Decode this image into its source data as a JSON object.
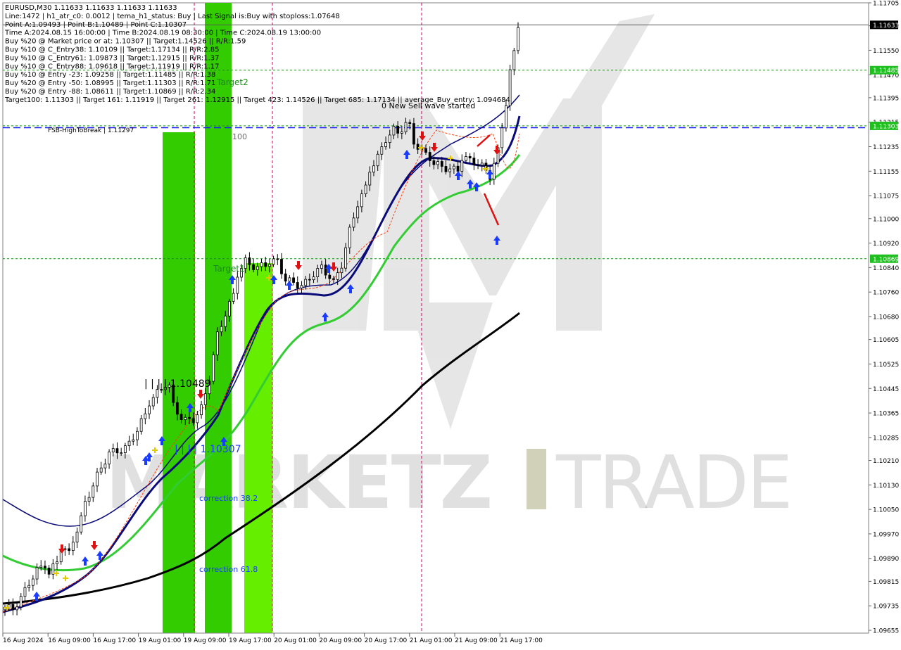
{
  "chart_header": {
    "info_lines": [
      "EURUSD,M30  1.11633 1.11633 1.11633 1.11633",
      "Line:1472  |  h1_atr_c0: 0.0012  |  tema_h1_status: Buy  |  Last Signal is:Buy with stoploss:1.07648",
      "Point A:1.09493  |  Point B:1.10489  |  Point C:1.10307",
      "Time A:2024.08.15 16:00:00  |  Time B:2024.08.19 08:30:00  |  Time C:2024.08.19 13:00:00",
      "Buy %20 @ Market price or at: 1.10307  ||  Target:1.14526  ||  R/R:1.59",
      "Buy %10 @ C_Entry38: 1.10109  ||  Target:1.17134  ||  R/R:2.85",
      "Buy %10 @ C_Entry61: 1.09873  ||  Target:1.12915  ||  R/R:1.37",
      "Buy %10 @ C_Entry88: 1.09618  ||  Target:1.11919  ||  R/R:1.17",
      "Buy %10 @ Entry -23: 1.09258  ||  Target:1.11485  ||  R/R:1.38",
      "Buy %20 @ Entry -50: 1.08995  ||  Target:1.11303  ||  R/R:1.71",
      "Buy %20 @ Entry -88: 1.08611  ||  Target:1.10869  ||  R/R:2.34",
      "Target100: 1.11303  ||  Target 161: 1.11919  ||  Target 261: 1.12915  ||  Target 423: 1.14526  ||  Target 685: 1.17134  ||  average_Buy_entry: 1.094684"
    ]
  },
  "annotations": {
    "target2": "Target2",
    "target1": "Target1",
    "fsb": "FSB-HighToBreak  |  1.11297",
    "level_100": "100",
    "new_sell": "0 New Sell wave started",
    "point_b_label": "| | | | 1.10489",
    "point_c_label": "| | | | 1.10307",
    "correction_382": "correction 38.2",
    "correction_618": "correction 61.8"
  },
  "watermark": {
    "brand_left": "MARKETZ",
    "brand_right": "TRADE"
  },
  "price_tags": [
    {
      "value": "1.11633",
      "price": 1.11633,
      "bg": "#000000",
      "fg": "#ffffff"
    },
    {
      "value": "1.11485",
      "price": 1.11485,
      "bg": "#1fbf1f",
      "fg": "#ffffff"
    },
    {
      "value": "1.11303",
      "price": 1.11303,
      "bg": "#1fbf1f",
      "fg": "#ffffff"
    },
    {
      "value": "1.10869",
      "price": 1.10869,
      "bg": "#1fbf1f",
      "fg": "#ffffff"
    }
  ],
  "colors": {
    "zone_green": "#33cc00",
    "zone_green_light": "#66ee00",
    "candle": "#000000",
    "ma_blue": "#0a0a78",
    "ma_green": "#33cc33",
    "ma_black": "#000000",
    "level_green": "#1a8c1a",
    "level_blue": "#1a1aff",
    "vline": "#cc0066",
    "buy_arrow": "#1a3cff",
    "sell_arrow": "#e01010"
  },
  "chart_data": {
    "type": "candlestick",
    "symbol": "EURUSD",
    "timeframe": "M30",
    "ylim": [
      1.09655,
      1.11705
    ],
    "y_ticks": [
      "1.11705",
      "1.11630",
      "1.11550",
      "1.11470",
      "1.11395",
      "1.11315",
      "1.11235",
      "1.11155",
      "1.11075",
      "1.11000",
      "1.10920",
      "1.10840",
      "1.10760",
      "1.10680",
      "1.10605",
      "1.10525",
      "1.10445",
      "1.10365",
      "1.10285",
      "1.10210",
      "1.10130",
      "1.10050",
      "1.09970",
      "1.09890",
      "1.09815",
      "1.09735",
      "1.09655"
    ],
    "x_ticks": [
      "16 Aug 2024",
      "16 Aug 09:00",
      "16 Aug 17:00",
      "19 Aug 01:00",
      "19 Aug 09:00",
      "19 Aug 17:00",
      "20 Aug 01:00",
      "20 Aug 09:00",
      "20 Aug 17:00",
      "21 Aug 01:00",
      "21 Aug 09:00",
      "21 Aug 17:00"
    ],
    "levels": [
      {
        "name": "current",
        "price": 1.11633
      },
      {
        "name": "target2",
        "price": 1.11485
      },
      {
        "name": "target100",
        "price": 1.11303
      },
      {
        "name": "fsb-high-to-break",
        "price": 1.11297
      },
      {
        "name": "target1",
        "price": 1.10869
      }
    ],
    "close_path": [
      [
        0,
        1.0973
      ],
      [
        2,
        1.09725
      ],
      [
        4,
        1.0976
      ],
      [
        6,
        1.0981
      ],
      [
        8,
        1.0985
      ],
      [
        10,
        1.0987
      ],
      [
        11,
        1.0984
      ],
      [
        13,
        1.0988
      ],
      [
        14,
        1.0993
      ],
      [
        16,
        1.09905
      ],
      [
        17,
        1.0995
      ],
      [
        19,
        1.1002
      ],
      [
        20,
        1.1007
      ],
      [
        21,
        1.101
      ],
      [
        23,
        1.1016
      ],
      [
        25,
        1.1021
      ],
      [
        26,
        1.10235
      ],
      [
        28,
        1.1024
      ],
      [
        30,
        1.1025
      ],
      [
        31,
        1.10265
      ],
      [
        33,
        1.1031
      ],
      [
        35,
        1.1036
      ],
      [
        36,
        1.104
      ],
      [
        38,
        1.1043
      ],
      [
        40,
        1.1046
      ],
      [
        41,
        1.1045
      ],
      [
        42,
        1.1039
      ],
      [
        44,
        1.1035
      ],
      [
        45,
        1.1034
      ],
      [
        47,
        1.10345
      ],
      [
        48,
        1.1036
      ],
      [
        49,
        1.1038
      ],
      [
        51,
        1.1048
      ],
      [
        53,
        1.1062
      ],
      [
        55,
        1.1069
      ],
      [
        57,
        1.1075
      ],
      [
        58,
        1.1082
      ],
      [
        60,
        1.1086
      ],
      [
        61,
        1.1085
      ],
      [
        63,
        1.1084
      ],
      [
        65,
        1.1085
      ],
      [
        66,
        1.1086
      ],
      [
        68,
        1.1086
      ],
      [
        70,
        1.108
      ],
      [
        72,
        1.1079
      ],
      [
        74,
        1.1078
      ],
      [
        75,
        1.1079
      ],
      [
        77,
        1.1082
      ],
      [
        79,
        1.1084
      ],
      [
        81,
        1.1081
      ],
      [
        82,
        1.1079
      ],
      [
        84,
        1.1085
      ],
      [
        86,
        1.1096
      ],
      [
        88,
        1.1105
      ],
      [
        90,
        1.111
      ],
      [
        91,
        1.1116
      ],
      [
        93,
        1.112
      ],
      [
        95,
        1.1126
      ],
      [
        97,
        1.1129
      ],
      [
        98,
        1.1128
      ],
      [
        100,
        1.1131
      ],
      [
        101,
        1.113
      ],
      [
        102,
        1.1125
      ],
      [
        104,
        1.1122
      ],
      [
        106,
        1.112
      ],
      [
        107,
        1.1118
      ],
      [
        109,
        1.1117
      ],
      [
        111,
        1.1116
      ],
      [
        113,
        1.1116
      ],
      [
        114,
        1.112
      ],
      [
        116,
        1.1119
      ],
      [
        118,
        1.1118
      ],
      [
        119,
        1.1117
      ],
      [
        121,
        1.1114
      ],
      [
        122,
        1.1118
      ],
      [
        123,
        1.1122
      ],
      [
        125,
        1.1138
      ],
      [
        126,
        1.1148
      ],
      [
        127,
        1.1154
      ],
      [
        128,
        1.11633
      ]
    ]
  }
}
